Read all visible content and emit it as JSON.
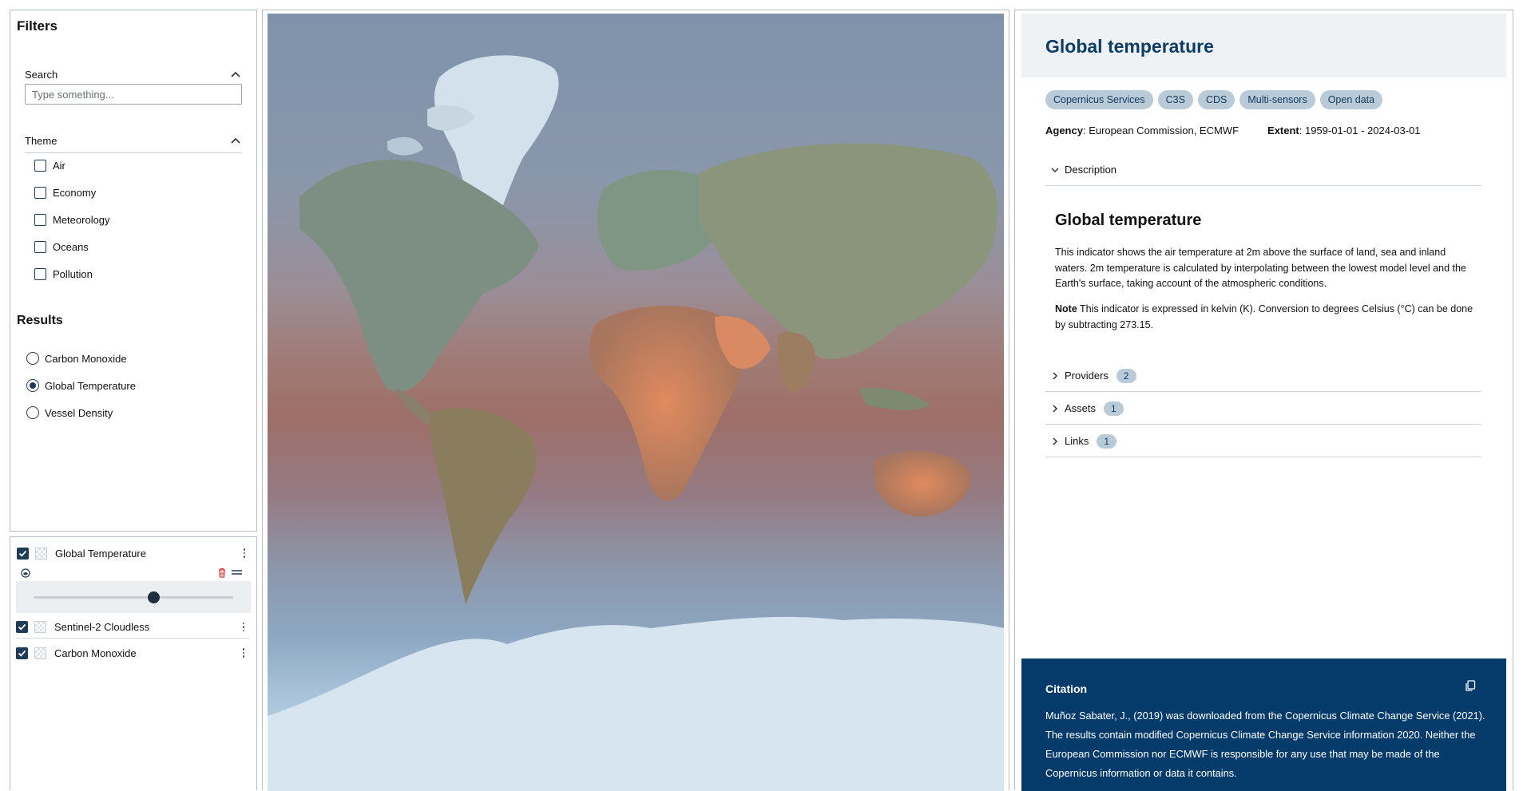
{
  "filters": {
    "title": "Filters",
    "search_label": "Search",
    "search_placeholder": "Type something...",
    "theme_label": "Theme",
    "themes": [
      "Air",
      "Economy",
      "Meteorology",
      "Oceans",
      "Pollution"
    ]
  },
  "results": {
    "title": "Results",
    "items": [
      {
        "label": "Carbon Monoxide",
        "selected": false
      },
      {
        "label": "Global Temperature",
        "selected": true
      },
      {
        "label": "Vessel Density",
        "selected": false
      }
    ]
  },
  "layers": {
    "items": [
      {
        "label": "Global Temperature",
        "checked": true
      },
      {
        "label": "Sentinel-2 Cloudless",
        "checked": true
      },
      {
        "label": "Carbon Monoxide",
        "checked": true
      }
    ],
    "opacity": 0.6
  },
  "detail": {
    "title": "Global temperature",
    "tags": [
      "Copernicus Services",
      "C3S",
      "CDS",
      "Multi-sensors",
      "Open data"
    ],
    "agency_label": "Agency",
    "agency_value": ": European Commission, ECMWF",
    "extent_label": "Extent",
    "extent_value": ": 1959-01-01 - 2024-03-01",
    "description_label": "Description",
    "description_title": "Global temperature",
    "description_text": "This indicator shows the air temperature at 2m above the surface of land, sea and inland waters. 2m temperature is calculated by interpolating between the lowest model level and the Earth's surface, taking account of the atmospheric conditions.",
    "note_label": "Note",
    "note_text": " This indicator is expressed in kelvin (K). Conversion to degrees Celsius (°C) can be done by subtracting 273.15.",
    "providers_label": "Providers",
    "providers_count": "2",
    "assets_label": "Assets",
    "assets_count": "1",
    "links_label": "Links",
    "links_count": "1"
  },
  "citation": {
    "title": "Citation",
    "text": "Muñoz Sabater, J., (2019) was downloaded from the Copernicus Climate Change Service (2021). The results contain modified Copernicus Climate Change Service information 2020. Neither the European Commission nor ECMWF is responsible for any use that may be made of the Copernicus information or data it contains."
  },
  "colors": {
    "accent": "#0d3d66",
    "citation_bg": "#053b6b",
    "tag_bg": "#b9cad9"
  }
}
